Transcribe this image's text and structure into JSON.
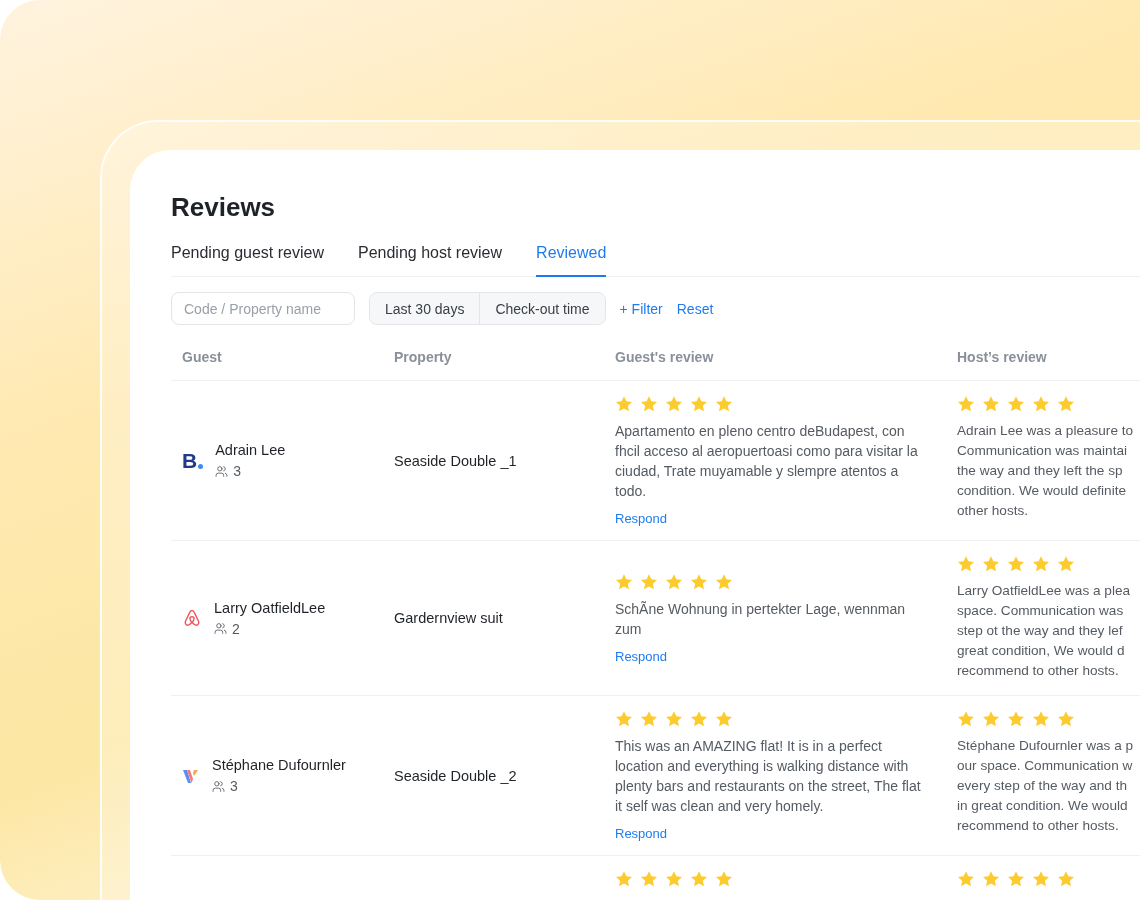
{
  "title": "Reviews",
  "tabs": [
    {
      "label": "Pending guest review",
      "selected": false
    },
    {
      "label": "Pending host review",
      "selected": false
    },
    {
      "label": "Reviewed",
      "selected": true
    }
  ],
  "search": {
    "placeholder": "Code / Property name"
  },
  "filters": [
    {
      "label": "Last 30 days"
    },
    {
      "label": "Check-out time"
    }
  ],
  "links": [
    "+ Filter",
    "Reset"
  ],
  "table": {
    "columns": [
      "Guest",
      "Property",
      "Guest's review",
      "Host’s review"
    ],
    "rows": [
      {
        "channel": {
          "kind": "booking",
          "label": "B"
        },
        "guest": "Adrain Lee",
        "guests": "3",
        "property": "Seaside Double _1",
        "guest_review": {
          "stars": 5,
          "text": "Apartamento en pleno centro deBudapest, con fhcil acceso al aeropuertoasi como para visitar la ciudad, Trate muyamable y slempre atentos a todo.",
          "action": "Respond"
        },
        "host_review": {
          "stars": 5,
          "lines": [
            "Adrain Lee was a pleasure to",
            "Communication was maintai",
            "the way and they left the sp",
            "condition. We would definite",
            "other hosts."
          ]
        }
      },
      {
        "channel": {
          "kind": "airbnb"
        },
        "guest": "Larry OatfieldLee",
        "guests": "2",
        "property": "Gardernview suit",
        "guest_review": {
          "stars": 5,
          "text": "SchÃne Wohnung in pertekter Lage, wennman zum",
          "action": "Respond"
        },
        "host_review": {
          "stars": 5,
          "lines": [
            "Larry OatfieldLee was a plea",
            "space. Communication was",
            "step ot the way and they lef",
            "great condition, We would d",
            "recommend to other hosts."
          ]
        }
      },
      {
        "channel": {
          "kind": "vrbo"
        },
        "guest": "Stéphane Dufournler",
        "guests": "3",
        "property": "Seaside Double _2",
        "guest_review": {
          "stars": 5,
          "text": "This was an AMAZING flat! It is in a perfect location and everything is walking distance with plenty bars and restaurants on the street, The flat it self was clean and very homely.",
          "action": "Respond"
        },
        "host_review": {
          "stars": 5,
          "lines": [
            "Stéphane Dufournler was a p",
            "our space. Communication w",
            "every step of the way and th",
            "in great condition. We would",
            "recommend to other hosts."
          ]
        }
      },
      {
        "guest_review": {
          "stars": 5
        },
        "host_review": {
          "stars": 5
        }
      }
    ]
  }
}
